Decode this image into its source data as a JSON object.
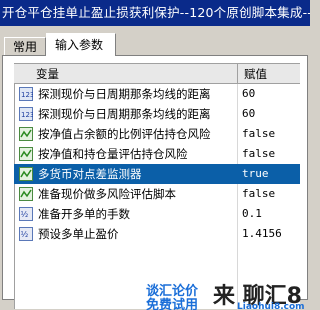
{
  "window": {
    "title": "开仓平仓挂单止盈止损获利保护--120个原创脚本集成--"
  },
  "tabs": [
    {
      "label": "常用"
    },
    {
      "label": "输入参数"
    }
  ],
  "table": {
    "col_variable": "变量",
    "col_value": "赋值",
    "rows": [
      {
        "icon": "int-param-icon",
        "name": "探测现价与日周期那条均线的距离",
        "value": "60",
        "selected": false
      },
      {
        "icon": "int-param-icon",
        "name": "探测现价与日周期那条均线的距离",
        "value": "60",
        "selected": false
      },
      {
        "icon": "bool-param-icon",
        "name": "按净值占余额的比例评估持仓风险",
        "value": "false",
        "selected": false
      },
      {
        "icon": "bool-param-icon",
        "name": "按净值和持仓量评估持仓风险",
        "value": "false",
        "selected": false
      },
      {
        "icon": "bool-param-icon",
        "name": "多货币对点差监测器",
        "value": "true",
        "selected": true
      },
      {
        "icon": "bool-param-icon",
        "name": "准备现价做多风险评估脚本",
        "value": "false",
        "selected": false
      },
      {
        "icon": "double-param-icon",
        "name": "准备开多单的手数",
        "value": "0.1",
        "selected": false
      },
      {
        "icon": "double-param-icon",
        "name": "预设多单止盈价",
        "value": "1.4156",
        "selected": false
      }
    ]
  },
  "watermark": {
    "line1": "谈汇论价",
    "line2": "免费试用",
    "brand": "来 聊汇8",
    "url": "Liaohui8.com"
  },
  "colors": {
    "title_bg": "#0a2a8a",
    "selection_bg": "#0b5fa8",
    "watermark_blue": "#1a6ed8",
    "watermark_red": "#d82020"
  }
}
